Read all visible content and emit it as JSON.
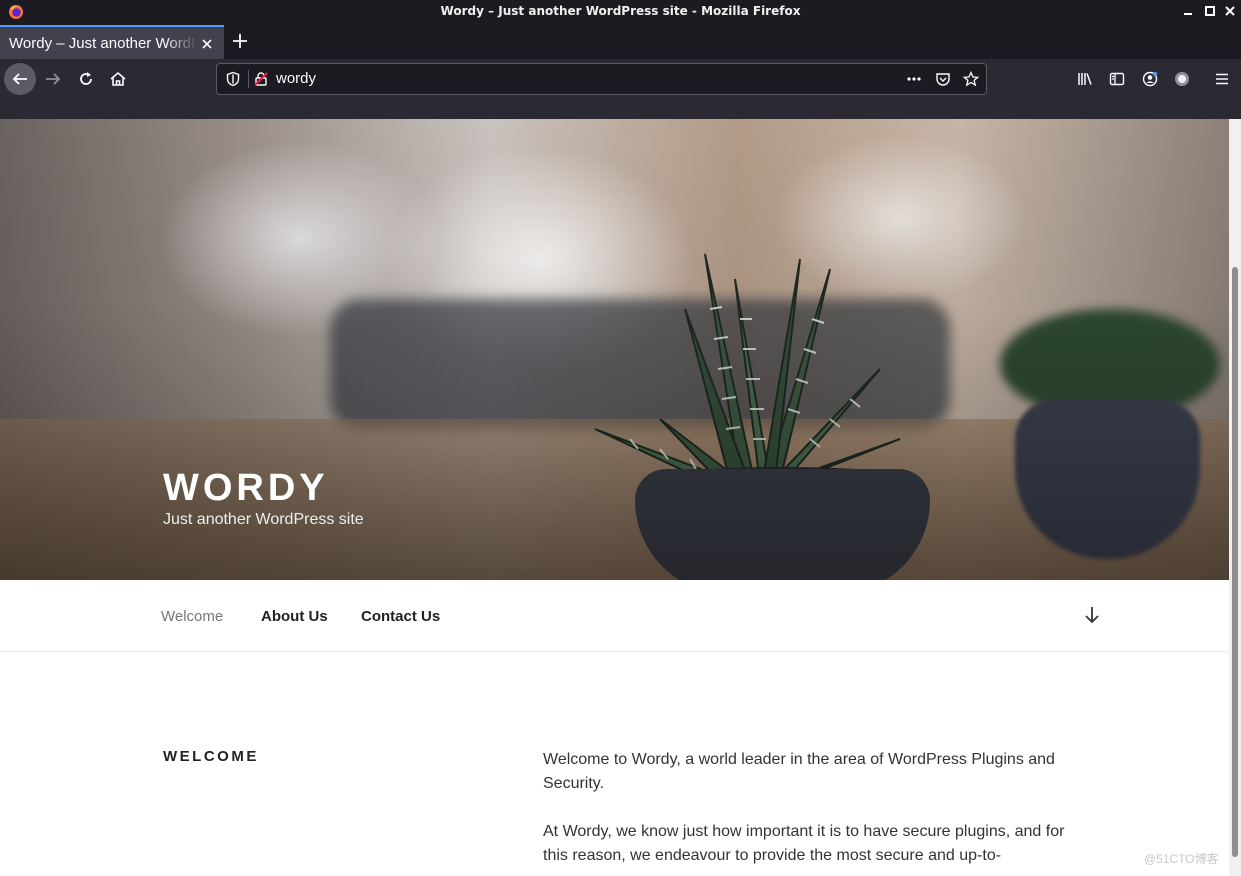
{
  "window": {
    "title": "Wordy – Just another WordPress site - Mozilla Firefox"
  },
  "tab": {
    "label": "Wordy – Just another WordPress site"
  },
  "urlbar": {
    "url": "wordy"
  },
  "site": {
    "title": "WORDY",
    "description": "Just another WordPress site",
    "menu": [
      "Welcome",
      "About Us",
      "Contact Us"
    ]
  },
  "page": {
    "heading": "WELCOME",
    "paragraphs": [
      "Welcome to Wordy, a world leader in the area of WordPress Plugins and Security.",
      "At Wordy, we know just how important it is to have secure plugins, and for this reason, we endeavour to provide the most secure and up-to-"
    ]
  },
  "watermark": "@51CTO博客",
  "colors": {
    "chrome_dark": "#1c1b22",
    "toolbar": "#2b2a33",
    "tab_accent": "#4d9bff"
  }
}
